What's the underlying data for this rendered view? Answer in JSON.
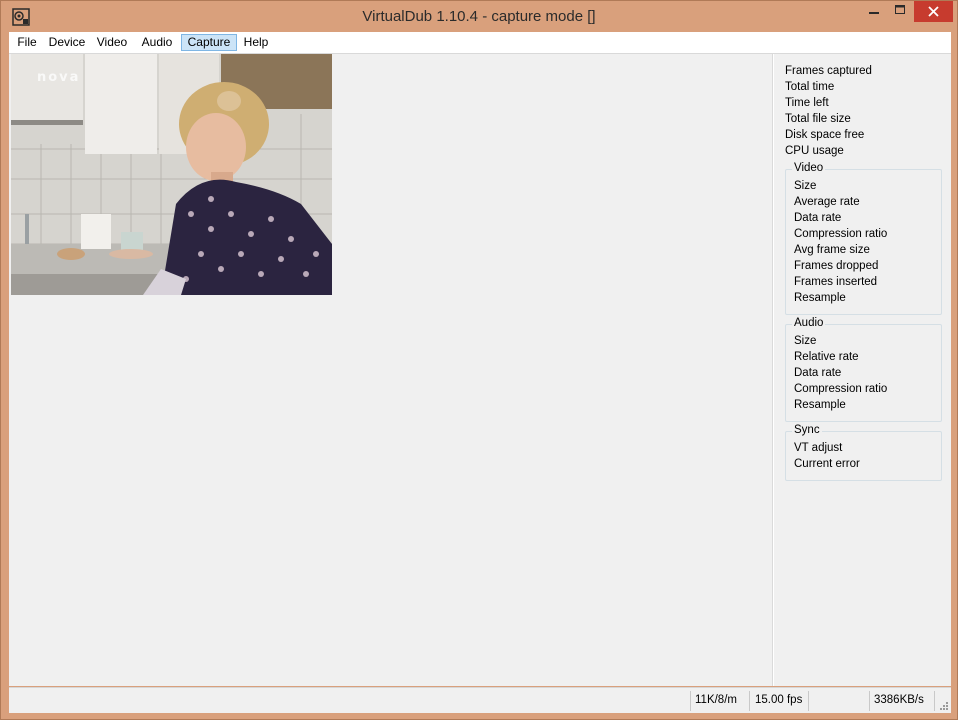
{
  "window": {
    "title": "VirtualDub 1.10.4 - capture mode []",
    "app_icon": "virtualdub-app-icon",
    "controls": {
      "minimize": "minimize-icon",
      "maximize": "maximize-icon",
      "close": "close-icon"
    }
  },
  "menu": {
    "items": [
      {
        "label": "File"
      },
      {
        "label": "Device"
      },
      {
        "label": "Video"
      },
      {
        "label": "Audio"
      },
      {
        "label": "Capture",
        "active": true
      },
      {
        "label": "Help"
      }
    ]
  },
  "preview": {
    "channel_logo": "nova"
  },
  "stats": {
    "frames_captured": "Frames captured",
    "total_time": "Total time",
    "time_left": "Time left",
    "total_file_size": "Total file size",
    "disk_space_free": "Disk space free",
    "cpu_usage": "CPU usage",
    "video": {
      "title": "Video",
      "items": [
        "Size",
        "Average rate",
        "Data rate",
        "Compression ratio",
        "Avg frame size",
        "Frames dropped",
        "Frames inserted",
        "Resample"
      ]
    },
    "audio": {
      "title": "Audio",
      "items": [
        "Size",
        "Relative rate",
        "Data rate",
        "Compression ratio",
        "Resample"
      ]
    },
    "sync": {
      "title": "Sync",
      "items": [
        "VT adjust",
        "Current error"
      ]
    }
  },
  "status": {
    "audio_format": "11K/8/m",
    "fps": "15.00 fps",
    "data_rate": "3386KB/s"
  },
  "colors": {
    "frame": "#d9a07c",
    "close_button": "#c73b2e",
    "menu_active_bg": "#cce4f7",
    "client_bg": "#f0f0f0"
  }
}
